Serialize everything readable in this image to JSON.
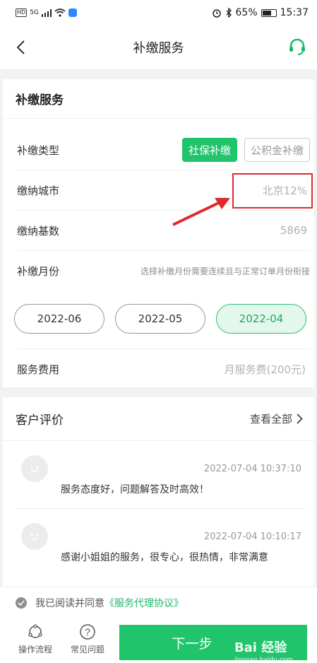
{
  "status_bar": {
    "left_text": "HD",
    "signal": "5G",
    "battery": "65%",
    "time": "15:37"
  },
  "nav": {
    "title": "补缴服务"
  },
  "service": {
    "header": "补缴服务",
    "type_label": "补缴类型",
    "type_options": [
      "社保补缴",
      "公积金补缴"
    ],
    "city_label": "缴纳城市",
    "city_value": "北京12%",
    "base_label": "缴纳基数",
    "base_value": "5869",
    "month_label": "补缴月份",
    "month_hint": "选择补缴月份需要连续且与正常订单月份衔接",
    "months": [
      "2022-06",
      "2022-05",
      "2022-04"
    ],
    "fee_label": "服务费用",
    "fee_value": "月服务费(200元)"
  },
  "reviews": {
    "header": "客户评价",
    "view_all": "查看全部",
    "items": [
      {
        "time": "2022-07-04 10:37:10",
        "text": "服务态度好，问题解答及时高效！"
      },
      {
        "time": "2022-07-04 10:10:17",
        "text": "感谢小姐姐的服务，很专心，很热情，非常满意"
      }
    ]
  },
  "agree": {
    "prefix": "我已阅读并同意",
    "link": "《服务代理协议》"
  },
  "bottom": {
    "process": "操作流程",
    "faq": "常见问题",
    "next": "下一步",
    "watermark": "Bai 经验",
    "watermark_sub": "jingyan.baidu.com"
  },
  "colors": {
    "accent": "#1fc46b",
    "highlight": "#e0292c"
  }
}
